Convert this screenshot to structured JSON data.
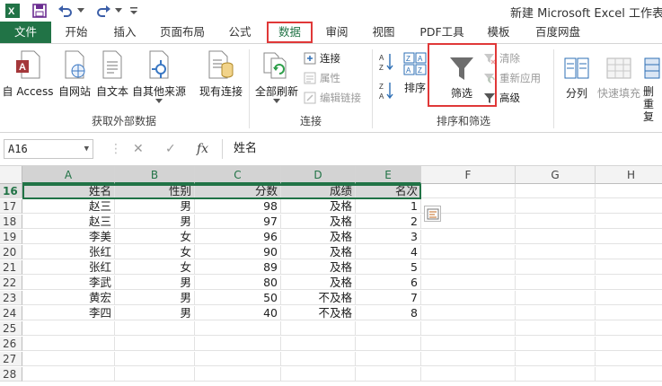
{
  "window": {
    "title": "新建 Microsoft Excel 工作表.xl"
  },
  "tabs": {
    "file": "文件",
    "home": "开始",
    "insert": "插入",
    "layout": "页面布局",
    "formulas": "公式",
    "data": "数据",
    "review": "审阅",
    "view": "视图",
    "pdf": "PDF工具",
    "template": "模板",
    "baidu": "百度网盘"
  },
  "ribbon": {
    "get_external": {
      "access": "自 Access",
      "web": "自网站",
      "text": "自文本",
      "other": "自其他来源",
      "existing": "现有连接",
      "label": "获取外部数据"
    },
    "connections": {
      "refresh_all": "全部刷新",
      "connections": "连接",
      "properties": "属性",
      "edit_links": "编辑链接",
      "label": "连接"
    },
    "sort_filter": {
      "sort": "排序",
      "filter": "筛选",
      "clear": "清除",
      "reapply": "重新应用",
      "advanced": "高级",
      "label": "排序和筛选"
    },
    "data_tools": {
      "split": "分列",
      "flash_fill": "快速填充",
      "remove_top": "删",
      "remove_bottom": "重复"
    }
  },
  "formula_bar": {
    "name_box": "A16",
    "cancel": "✕",
    "enter": "✓",
    "fx": "fx",
    "content": "姓名"
  },
  "sheet": {
    "columns": [
      "A",
      "B",
      "C",
      "D",
      "E",
      "F",
      "G",
      "H"
    ],
    "row_numbers": [
      "16",
      "17",
      "18",
      "19",
      "20",
      "21",
      "22",
      "23",
      "24",
      "25",
      "26",
      "27",
      "28"
    ],
    "header": [
      "姓名",
      "性别",
      "分数",
      "成绩",
      "名次"
    ],
    "rows": [
      [
        "赵三",
        "男",
        "98",
        "及格",
        "1"
      ],
      [
        "赵三",
        "男",
        "97",
        "及格",
        "2"
      ],
      [
        "李美",
        "女",
        "96",
        "及格",
        "3"
      ],
      [
        "张红",
        "女",
        "90",
        "及格",
        "4"
      ],
      [
        "张红",
        "女",
        "89",
        "及格",
        "5"
      ],
      [
        "李武",
        "男",
        "80",
        "及格",
        "6"
      ],
      [
        "黄宏",
        "男",
        "50",
        "不及格",
        "7"
      ],
      [
        "李四",
        "男",
        "40",
        "不及格",
        "8"
      ]
    ]
  },
  "colors": {
    "accent": "#217346",
    "highlight": "#e03838"
  }
}
